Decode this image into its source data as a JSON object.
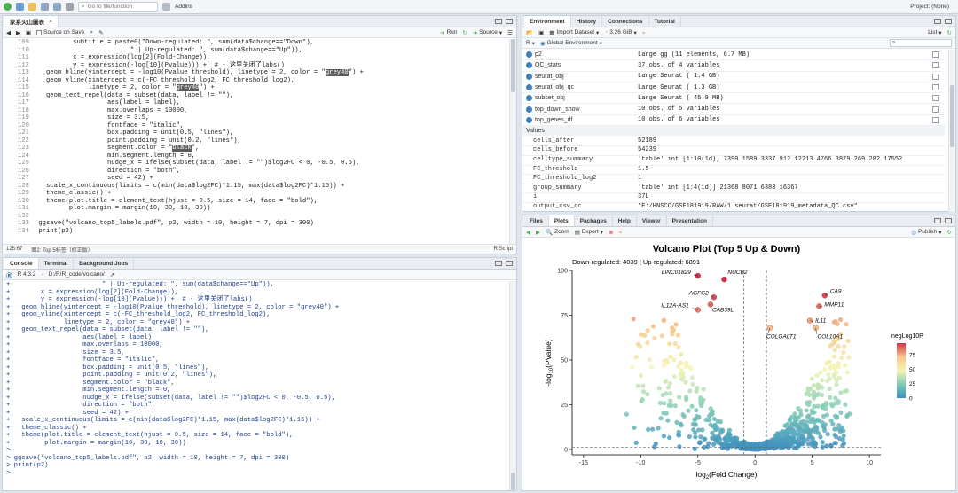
{
  "topbar": {
    "goto_placeholder": "Go to file/function",
    "addins": "Addins",
    "project": "Project: (None)"
  },
  "editor": {
    "tab_title": "家系火山圖表",
    "source_on_save": "Source on Save",
    "run": "Run",
    "source": "Source",
    "status_pos": "125:67",
    "status_ctx": "图2: Top 5标签（修正版）",
    "status_lang": "R Script",
    "lines": [
      {
        "n": "109",
        "t": "          subtitle = paste0(\"Down-regulated: \", sum(data$change==\"Down\"),"
      },
      {
        "n": "110",
        "t": "                         \" | Up-regulated: \", sum(data$change==\"Up\")),"
      },
      {
        "n": "111",
        "t": "          x = expression(log[2](Fold-Change)),"
      },
      {
        "n": "112",
        "t": "          y = expression(-log[10](Pvalue))) +  # - 这里关闭了labs()"
      },
      {
        "n": "113",
        "t": "   geom_hline(yintercept = -log10(Pvalue_threshold), linetype = 2, color = \"grey40\") +",
        "hl": "grey40"
      },
      {
        "n": "114",
        "t": "   geom_vline(xintercept = c(-FC_threshold_log2, FC_threshold_log2),"
      },
      {
        "n": "115",
        "t": "              linetype = 2, color = \"grey40\") +",
        "hl": "grey40"
      },
      {
        "n": "116",
        "t": "   geom_text_repel(data = subset(data, label != \"\"),"
      },
      {
        "n": "117",
        "t": "                   aes(label = label),"
      },
      {
        "n": "118",
        "t": "                   max.overlaps = 10000,"
      },
      {
        "n": "119",
        "t": "                   size = 3.5,"
      },
      {
        "n": "120",
        "t": "                   fontface = \"italic\","
      },
      {
        "n": "121",
        "t": "                   box.padding = unit(0.5, \"lines\"),"
      },
      {
        "n": "122",
        "t": "                   point.padding = unit(0.2, \"lines\"),"
      },
      {
        "n": "123",
        "t": "                   segment.color = \"black\",",
        "hl": "black"
      },
      {
        "n": "124",
        "t": "                   min.segment.length = 0,"
      },
      {
        "n": "125",
        "t": "                   nudge_x = ifelse(subset(data, label != \"\")$log2FC < 0, -0.5, 0.5),"
      },
      {
        "n": "126",
        "t": "                   direction = \"both\","
      },
      {
        "n": "127",
        "t": "                   seed = 42) +"
      },
      {
        "n": "128",
        "t": "   scale_x_continuous(limits = c(min(data$log2FC)*1.15, max(data$log2FC)*1.15)) +"
      },
      {
        "n": "129",
        "t": "   theme_classic() +"
      },
      {
        "n": "130",
        "t": "   theme(plot.title = element_text(hjust = 0.5, size = 14, face = \"bold\"),"
      },
      {
        "n": "131",
        "t": "         plot.margin = margin(10, 30, 10, 30))"
      },
      {
        "n": "132",
        "t": ""
      },
      {
        "n": "133",
        "t": " ggsave(\"volcano_top5_labels.pdf\", p2, width = 10, height = 7, dpi = 300)"
      },
      {
        "n": "134",
        "t": " print(p2)"
      }
    ]
  },
  "console": {
    "tabs": [
      "Console",
      "Terminal",
      "Background Jobs"
    ],
    "rversion": "R 4.3.2",
    "path": "D:/R/R_code/volcano/",
    "lines": [
      "+                        \" | Up-regulated: \", sum(data$change==\"Up\")),",
      "+        x = expression(log[2](Fold-Change)),",
      "+        y = expression(-log[10](Pvalue))) +  # - 这里关闭了labs()",
      "+   geom_hline(yintercept = -log10(Pvalue_threshold), linetype = 2, color = \"grey40\") +",
      "+   geom_vline(xintercept = c(-FC_threshold_log2, FC_threshold_log2),",
      "+              linetype = 2, color = \"grey40\") +",
      "+   geom_text_repel(data = subset(data, label != \"\"),",
      "+                   aes(label = label),",
      "+                   max.overlaps = 10000,",
      "+                   size = 3.5,",
      "+                   fontface = \"italic\",",
      "+                   box.padding = unit(0.5, \"lines\"),",
      "+                   point.padding = unit(0.2, \"lines\"),",
      "+                   segment.color = \"black\",",
      "+                   min.segment.length = 0,",
      "+                   nudge_x = ifelse(subset(data, label != \"\")$log2FC < 0, -0.5, 0.5),",
      "+                   direction = \"both\",",
      "+                   seed = 42) +",
      "+   scale_x_continuous(limits = c(min(data$log2FC)*1.15, max(data$log2FC)*1.15)) +",
      "+   theme_classic() +",
      "+   theme(plot.title = element_text(hjust = 0.5, size = 14, face = \"bold\"),",
      "+         plot.margin = margin(10, 30, 10, 30))",
      ">",
      "> ggsave(\"volcano_top5_labels.pdf\", p2, width = 10, height = 7, dpi = 300)",
      "> print(p2)",
      ">"
    ]
  },
  "env": {
    "tabs": [
      "Environment",
      "History",
      "Connections",
      "Tutorial"
    ],
    "import": "Import Dataset",
    "memory": "3.26 GiB",
    "list": "List",
    "lang": "R",
    "scope": "Global Environment",
    "data_rows": [
      {
        "name": "p2",
        "value": "Large gg (11 elements,  6.7 MB)"
      },
      {
        "name": "QC_stats",
        "value": "37 obs. of 4 variables"
      },
      {
        "name": "seurat_obj",
        "value": "Large Seurat ( 1.4 GB)"
      },
      {
        "name": "seurat_obj_qc",
        "value": "Large Seurat ( 1.3 GB)"
      },
      {
        "name": "subset_obj",
        "value": "Large Seurat ( 45.9 MB)"
      },
      {
        "name": "top_down_show",
        "value": "10 obs. of 5 variables"
      },
      {
        "name": "top_genes_df",
        "value": "10 obs. of 6 variables"
      }
    ],
    "values_label": "Values",
    "value_rows": [
      {
        "name": "cells_after",
        "value": "52189"
      },
      {
        "name": "cells_before",
        "value": "54239"
      },
      {
        "name": "celltype_summary",
        "value": "'table' int [1:10(1d)] 7390 1589 3337 912 12213 4766 3879 269 282 17552"
      },
      {
        "name": "FC_threshold",
        "value": "1.5"
      },
      {
        "name": "FC_threshold_log2",
        "value": "1"
      },
      {
        "name": "group_summary",
        "value": "'table' int [1:4(1d)] 21368 8071 6383 16367"
      },
      {
        "name": "i",
        "value": "37L"
      },
      {
        "name": "output_csv_qc",
        "value": "\"E:/HNSCC/GSE181919/RAW/1.seurat/GSE181919_metadata_QC.csv\""
      }
    ]
  },
  "plots": {
    "tabs": [
      "Files",
      "Plots",
      "Packages",
      "Help",
      "Viewer",
      "Presentation"
    ],
    "zoom": "Zoom",
    "export": "Export",
    "publish": "Publish"
  },
  "chart_data": {
    "type": "scatter",
    "title": "Volcano Plot (Top 5 Up & Down)",
    "subtitle": "Down-regulated: 4039 | Up-regulated: 6891",
    "xlabel_base": "log",
    "xlabel_sub": "2",
    "xlabel_rest": "(Fold Change)",
    "ylabel_pre": "-log",
    "ylabel_sub": "10",
    "ylabel_rest": "(PValue)",
    "xlim": [
      -16,
      11
    ],
    "ylim": [
      -3,
      100
    ],
    "xticks": [
      -15,
      -10,
      -5,
      0,
      5,
      10
    ],
    "yticks": [
      0,
      25,
      50,
      75,
      100
    ],
    "vlines": [
      -1,
      1
    ],
    "hline": 1.3,
    "legend_title": "negLog10P",
    "legend_ticks": [
      0,
      25,
      50,
      75
    ],
    "legend_placement": "right",
    "colors": {
      "high": "#d7304a",
      "mid_high": "#f7c68a",
      "mid": "#f5f5b5",
      "mid_low": "#7fcbb6",
      "low": "#3c8fc0"
    },
    "labels": [
      {
        "text": "LINC01829",
        "x": -5.0,
        "y": 97
      },
      {
        "text": "NUCB2",
        "x": -2.7,
        "y": 95
      },
      {
        "text": "AGFG2",
        "x": -3.6,
        "y": 85
      },
      {
        "text": "IL12A-AS1",
        "x": -5.0,
        "y": 78
      },
      {
        "text": "CAB39L",
        "x": -3.9,
        "y": 81
      },
      {
        "text": "CA9",
        "x": 6.1,
        "y": 86
      },
      {
        "text": "MMP11",
        "x": 5.6,
        "y": 80
      },
      {
        "text": "IL11",
        "x": 4.8,
        "y": 72
      },
      {
        "text": "COLGALT1",
        "x": 1.3,
        "y": 68
      },
      {
        "text": "COL10A1",
        "x": 5.3,
        "y": 68
      }
    ]
  }
}
